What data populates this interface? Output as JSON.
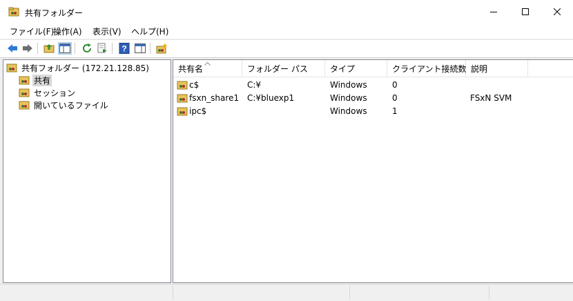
{
  "window": {
    "title": "共有フォルダー"
  },
  "menu": [
    "ファイル(F)",
    "操作(A)",
    "表示(V)",
    "ヘルプ(H)"
  ],
  "tree": {
    "root": "共有フォルダー (172.21.128.85)",
    "items": [
      "共有",
      "セッション",
      "開いているファイル"
    ],
    "selected": "共有"
  },
  "table": {
    "columns": [
      "共有名",
      "フォルダー パス",
      "タイプ",
      "クライアント接続数",
      "説明"
    ],
    "sort_column": "共有名",
    "rows": [
      {
        "name": "c$",
        "path": "C:¥",
        "type": "Windows",
        "clients": "0",
        "description": ""
      },
      {
        "name": "fsxn_share1",
        "path": "C:¥bluexp1",
        "type": "Windows",
        "clients": "0",
        "description": "FSxN SVM"
      },
      {
        "name": "ipc$",
        "path": "",
        "type": "Windows",
        "clients": "1",
        "description": ""
      }
    ]
  },
  "colors": {
    "selection": "#d9d9d9",
    "toolbar_active": "#cce4f7",
    "border": "#828790"
  }
}
